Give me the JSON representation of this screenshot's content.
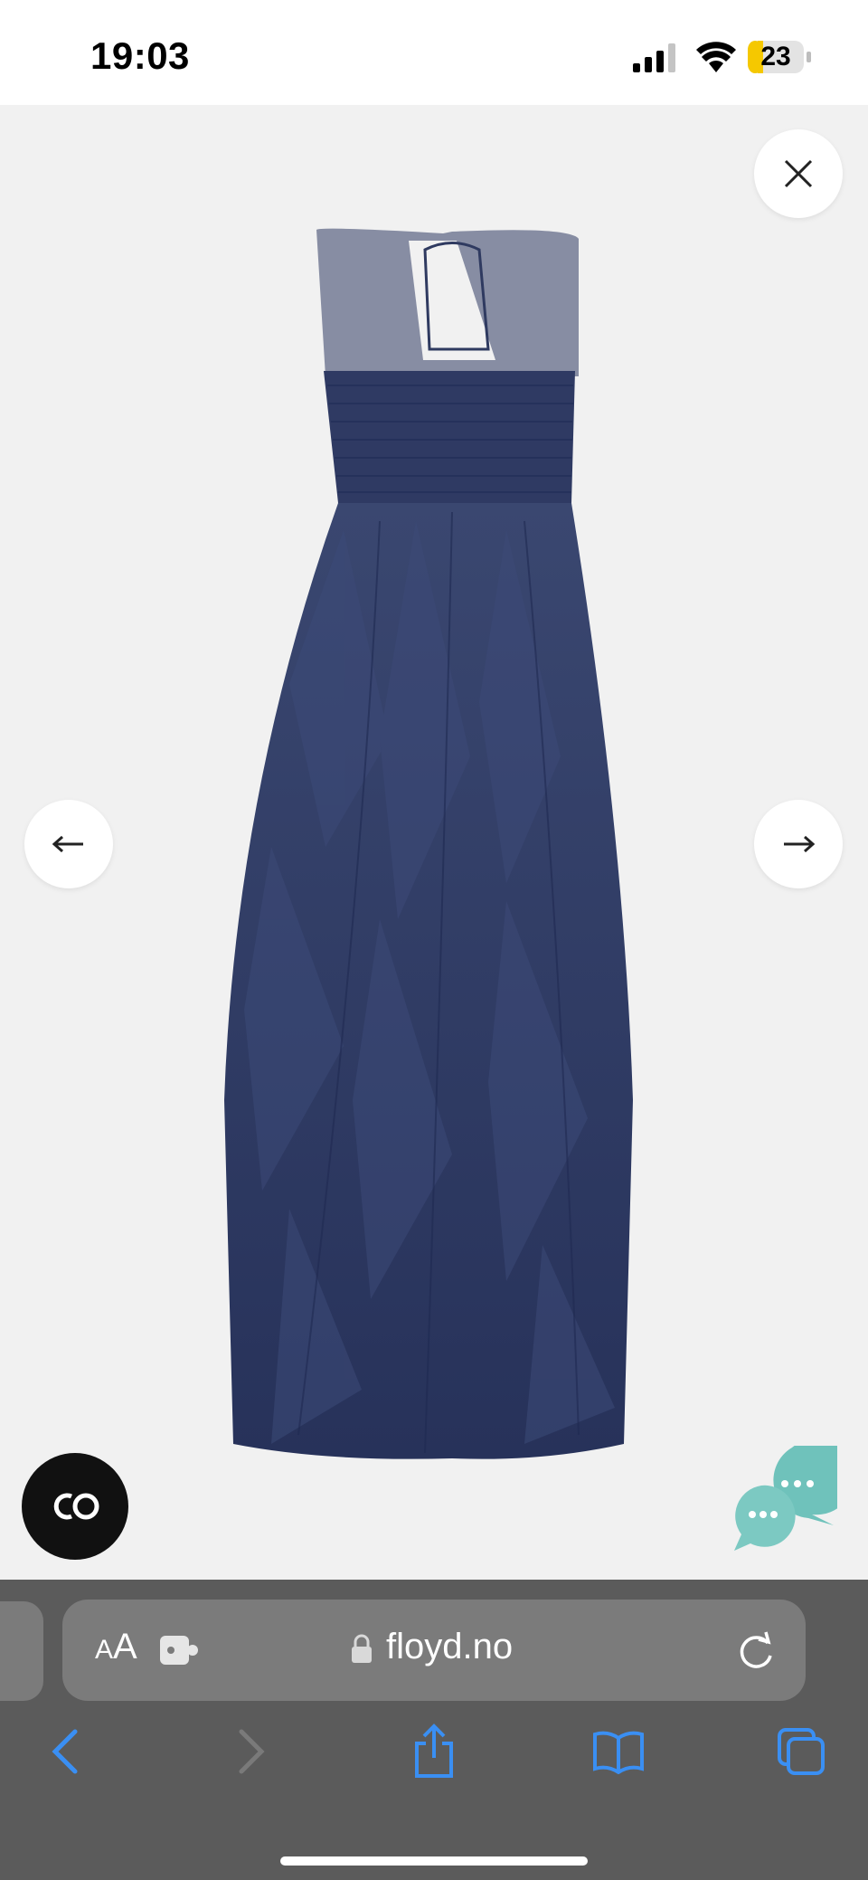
{
  "status_bar": {
    "time": "19:03",
    "battery_level": "23",
    "battery_color": "#f5c800"
  },
  "gallery": {
    "image_alt": "Navy tulle ruffle dress, back view",
    "dress_color": "#2e3a63",
    "close_icon": "close-icon",
    "prev_icon": "arrow-left-icon",
    "next_icon": "arrow-right-icon"
  },
  "overlays": {
    "co_badge_text": "CO",
    "chat_icon": "chat-bubbles-icon",
    "chat_color": "#6fc2bb"
  },
  "browser": {
    "text_size_small": "A",
    "text_size_large": "A",
    "url": "floyd.no",
    "reload_icon": "reload-icon",
    "nav_icons": [
      "back-icon",
      "forward-icon",
      "share-icon",
      "bookmarks-icon",
      "tabs-icon"
    ],
    "accent_color": "#3a8ff3"
  }
}
